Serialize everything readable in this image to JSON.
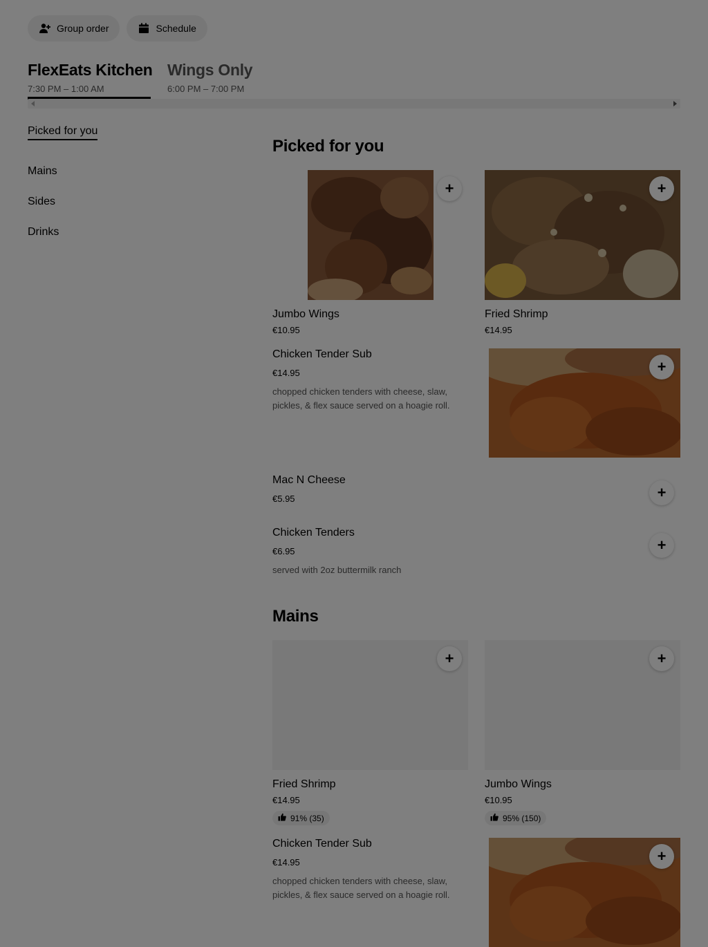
{
  "actions": {
    "group_order": "Group order",
    "schedule": "Schedule"
  },
  "menus": [
    {
      "name": "FlexEats Kitchen",
      "hours": "7:30 PM – 1:00 AM"
    },
    {
      "name": "Wings Only",
      "hours": "6:00 PM – 7:00 PM"
    }
  ],
  "sidebar": {
    "items": [
      {
        "label": "Picked for you"
      },
      {
        "label": "Mains"
      },
      {
        "label": "Sides"
      },
      {
        "label": "Drinks"
      }
    ]
  },
  "picked": {
    "title": "Picked for you",
    "cards": [
      {
        "name": "Jumbo Wings",
        "price": "€10.95"
      },
      {
        "name": "Fried Shrimp",
        "price": "€14.95"
      }
    ],
    "rows": [
      {
        "name": "Chicken Tender Sub",
        "price": "€14.95",
        "desc": "chopped chicken tenders with cheese, slaw, pickles, & flex sauce served on a hoagie roll."
      },
      {
        "name": "Mac N Cheese",
        "price": "€5.95"
      },
      {
        "name": "Chicken Tenders",
        "price": "€6.95",
        "desc": "served with 2oz buttermilk ranch"
      }
    ]
  },
  "mains": {
    "title": "Mains",
    "cards": [
      {
        "name": "Fried Shrimp",
        "price": "€14.95",
        "rating": "91% (35)"
      },
      {
        "name": "Jumbo Wings",
        "price": "€10.95",
        "rating": "95% (150)"
      }
    ],
    "rows": [
      {
        "name": "Chicken Tender Sub",
        "price": "€14.95",
        "desc": "chopped chicken tenders with cheese, slaw, pickles, & flex sauce served on a hoagie roll."
      }
    ]
  },
  "icons": {
    "add": "+",
    "group": "person-add-icon",
    "schedule": "calendar-icon",
    "rating": "thumbs-up-icon"
  },
  "colors": {
    "overlay": "rgba(0,0,0,0.5)",
    "text": "#000000",
    "muted": "#545454"
  }
}
